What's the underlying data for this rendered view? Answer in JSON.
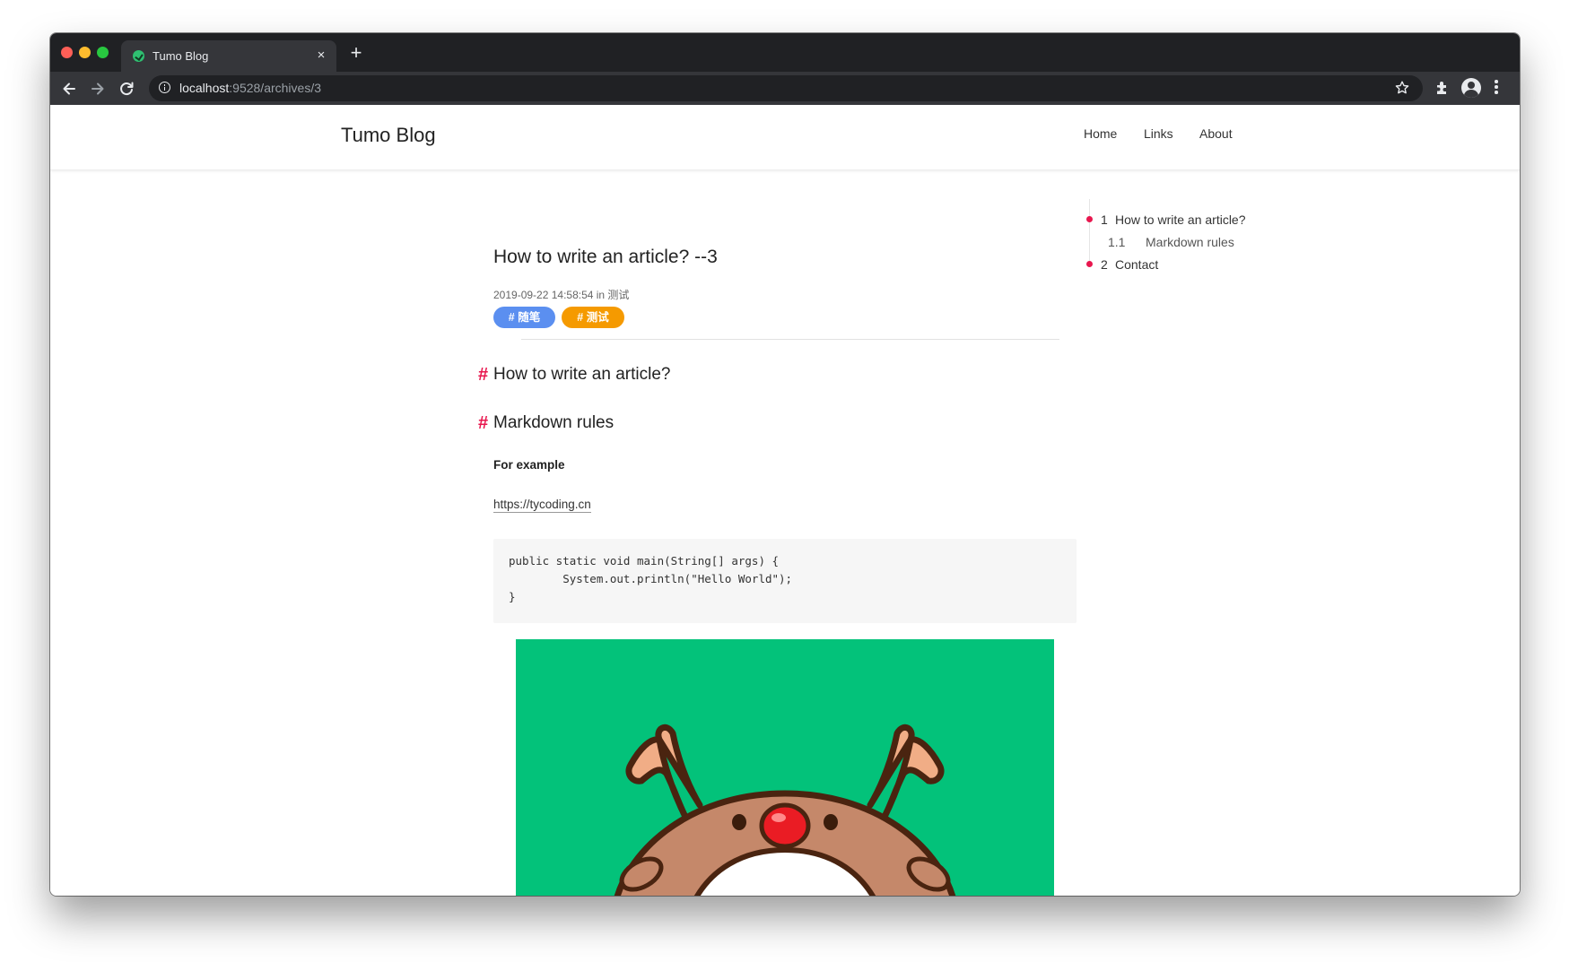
{
  "browser": {
    "tab_title": "Tumo Blog",
    "tab_close_glyph": "×",
    "new_tab_glyph": "+",
    "url_host": "localhost",
    "url_rest": ":9528/archives/3",
    "icons": [
      "back-arrow-icon",
      "forward-arrow-icon",
      "reload-icon",
      "info-icon",
      "star-icon",
      "extensions-icon",
      "profile-icon",
      "more-menu-icon"
    ]
  },
  "site": {
    "brand": "Tumo Blog",
    "nav": [
      "Home",
      "Links",
      "About"
    ]
  },
  "article": {
    "title": "How to write an article? --3",
    "meta": "2019-09-22 14:58:54 in 测试",
    "tags": [
      "# 随笔",
      "# 测试"
    ],
    "tag_colors": [
      "#5b8ff0",
      "#f59a00"
    ],
    "anchor_glyph": "#",
    "headings": [
      "How to write an article?",
      "Markdown rules"
    ],
    "bold_paragraph": "For example",
    "link": "https://tycoding.cn",
    "code_lines": [
      "public static void main(String[] args) {",
      "        System.out.println(\"Hello World\");",
      "}"
    ],
    "accent_color": "#e8174e"
  },
  "toc": [
    {
      "num": "1",
      "label": "How to write an article?"
    },
    {
      "num": "1.1",
      "label": "Markdown rules"
    },
    {
      "num": "2",
      "label": "Contact"
    }
  ]
}
